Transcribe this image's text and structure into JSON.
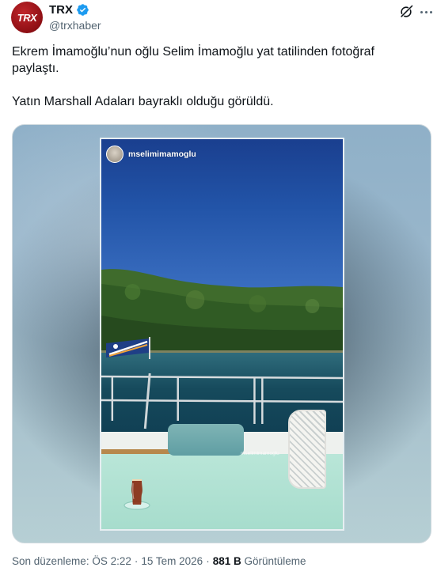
{
  "author": {
    "avatar_text": "TRX",
    "display_name": "TRX",
    "handle": "@trxhaber",
    "verified": true
  },
  "tweet": {
    "paragraphs": [
      "Ekrem İmamoğlu’nun oğlu Selim İmamoğlu yat tatilinden fotoğraf paylaştı.",
      "Yatın Marshall Adaları bayraklı olduğu görüldü."
    ]
  },
  "media": {
    "story_username": "mselimimamoglu",
    "watermark": "mselimimamoglu"
  },
  "meta": {
    "edited_prefix": "Son düzenleme:",
    "time": "ÖS 2:22",
    "date": "15 Tem 2026",
    "views_count": "881 B",
    "views_label": "Görüntüleme"
  },
  "icons": {
    "verified": "verified-badge-icon",
    "grok": "grok-icon",
    "more": "more-icon"
  },
  "colors": {
    "verified": "#1d9bf0",
    "secondary_text": "#536471",
    "primary_text": "#0f1419",
    "avatar_bg": "#a7161c"
  }
}
